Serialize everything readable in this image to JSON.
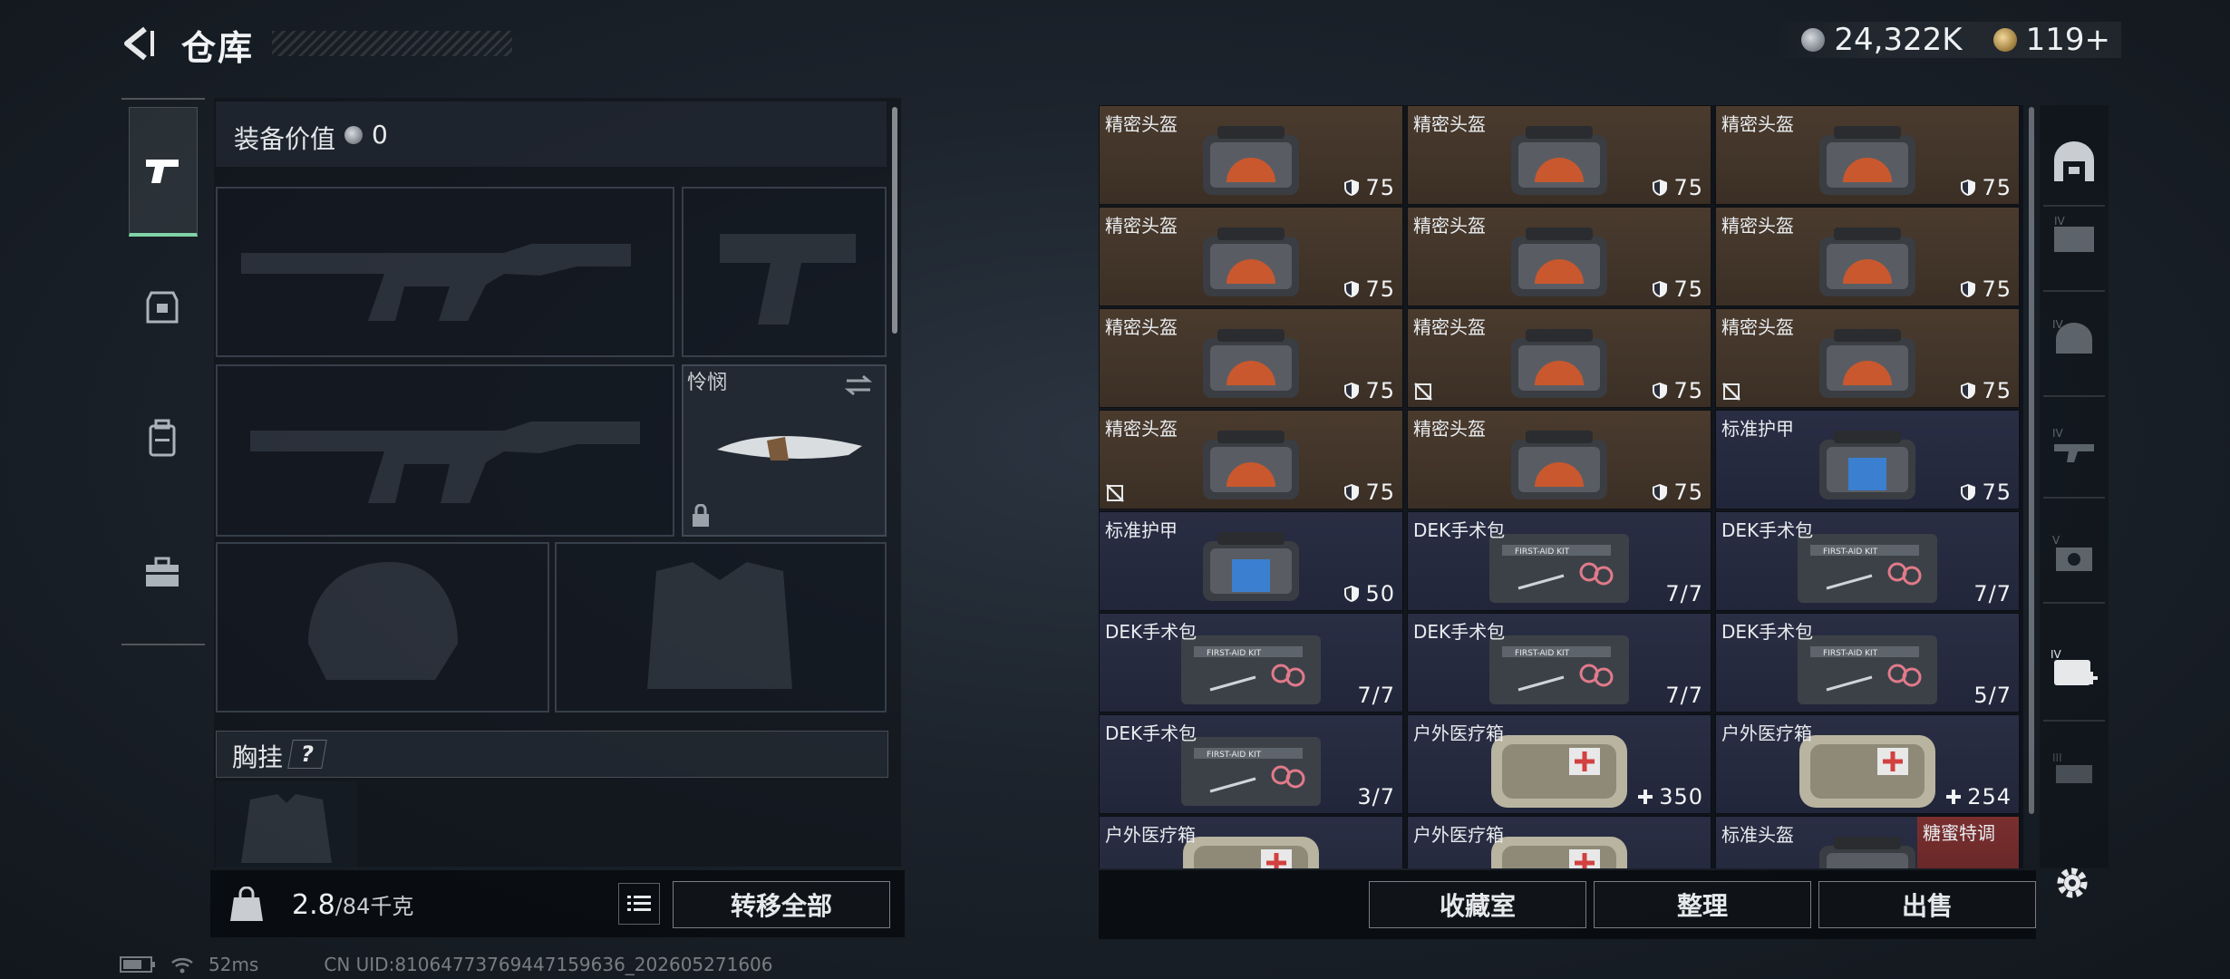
{
  "header": {
    "title": "仓库"
  },
  "currency": {
    "silver": "24,322K",
    "gold": "119+"
  },
  "left_tabs": [
    "weapon",
    "armor",
    "backpack",
    "toolbox"
  ],
  "equipment": {
    "value_label": "装备价值",
    "value": "0",
    "knife_label": "怜悯",
    "chest_label": "胸挂",
    "chest_help": "?"
  },
  "capacity": {
    "current": "2.8",
    "max": "/84千克"
  },
  "buttons": {
    "transfer_all": "转移全部",
    "vault": "收藏室",
    "sort": "整理",
    "sell": "出售"
  },
  "inventory": [
    {
      "name": "精密头盔",
      "value": "75",
      "kind": "helmet",
      "bg": "brown",
      "no_drop": false
    },
    {
      "name": "精密头盔",
      "value": "75",
      "kind": "helmet",
      "bg": "brown",
      "no_drop": false
    },
    {
      "name": "精密头盔",
      "value": "75",
      "kind": "helmet",
      "bg": "brown",
      "no_drop": false
    },
    {
      "name": "精密头盔",
      "value": "75",
      "kind": "helmet",
      "bg": "brown",
      "no_drop": false
    },
    {
      "name": "精密头盔",
      "value": "75",
      "kind": "helmet",
      "bg": "brown",
      "no_drop": false
    },
    {
      "name": "精密头盔",
      "value": "75",
      "kind": "helmet",
      "bg": "brown",
      "no_drop": false
    },
    {
      "name": "精密头盔",
      "value": "75",
      "kind": "helmet",
      "bg": "brown",
      "no_drop": false
    },
    {
      "name": "精密头盔",
      "value": "75",
      "kind": "helmet",
      "bg": "brown",
      "no_drop": true
    },
    {
      "name": "精密头盔",
      "value": "75",
      "kind": "helmet",
      "bg": "brown",
      "no_drop": true
    },
    {
      "name": "精密头盔",
      "value": "75",
      "kind": "helmet",
      "bg": "brown",
      "no_drop": true
    },
    {
      "name": "精密头盔",
      "value": "75",
      "kind": "helmet",
      "bg": "brown",
      "no_drop": false
    },
    {
      "name": "标准护甲",
      "value": "75",
      "kind": "armor",
      "bg": "blue",
      "no_drop": false
    },
    {
      "name": "标准护甲",
      "value": "50",
      "kind": "armor",
      "bg": "blue",
      "no_drop": false
    },
    {
      "name": "DEK手术包",
      "value": "7/7",
      "kind": "medkit",
      "bg": "blue",
      "no_drop": false
    },
    {
      "name": "DEK手术包",
      "value": "7/7",
      "kind": "medkit",
      "bg": "blue",
      "no_drop": false
    },
    {
      "name": "DEK手术包",
      "value": "7/7",
      "kind": "medkit",
      "bg": "blue",
      "no_drop": false
    },
    {
      "name": "DEK手术包",
      "value": "7/7",
      "kind": "medkit",
      "bg": "blue",
      "no_drop": false
    },
    {
      "name": "DEK手术包",
      "value": "5/7",
      "kind": "medkit",
      "bg": "blue",
      "no_drop": false
    },
    {
      "name": "DEK手术包",
      "value": "3/7",
      "kind": "medkit",
      "bg": "blue",
      "no_drop": false
    },
    {
      "name": "户外医疗箱",
      "value": "350",
      "kind": "firstaid",
      "bg": "blue",
      "no_drop": false
    },
    {
      "name": "户外医疗箱",
      "value": "254",
      "kind": "firstaid",
      "bg": "blue",
      "no_drop": false
    },
    {
      "name": "户外医疗箱",
      "value": "",
      "kind": "firstaid",
      "bg": "blue",
      "no_drop": false
    },
    {
      "name": "户外医疗箱",
      "value": "",
      "kind": "firstaid",
      "bg": "blue",
      "no_drop": false
    },
    {
      "name": "标准头盔",
      "value": "",
      "kind": "helmet",
      "bg": "blue",
      "no_drop": false,
      "tag": "糖蜜特调"
    }
  ],
  "status": {
    "ping": "52ms",
    "uid": "CN UID:81064773769447159636_202605271606"
  },
  "colors": {
    "accent_green": "#7fd3a6",
    "cell_brown": "#4a3b2e",
    "cell_blue": "#2a2e44",
    "cell_red": "#6a2a2a"
  }
}
